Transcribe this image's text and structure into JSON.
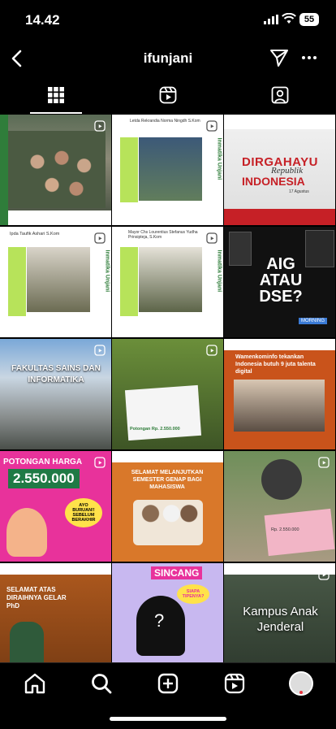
{
  "status": {
    "time": "14.42",
    "battery": "55"
  },
  "header": {
    "username": "ifunjani"
  },
  "tabs": [
    {
      "name": "grid"
    },
    {
      "name": "reels"
    },
    {
      "name": "tagged"
    }
  ],
  "posts": [
    {
      "caption": ""
    },
    {
      "caption": "Letda Rekrandia Norma Ningdh S.Kom",
      "side": "Inmatika Unjani"
    },
    {
      "title1": "DIRGAHAYU",
      "title2": "Republik",
      "title3": "INDONESIA",
      "date": "17 Agustus"
    },
    {
      "caption": "Ipda Taufik Ashari S.Kom",
      "side": "Inmatika Unjani"
    },
    {
      "caption": "Mayor Chs Lourentius Stefanus Yudha Prinsipteja, S.Kom",
      "side": "Inmatika Unjani"
    },
    {
      "text": "AIG ATAU DSE?",
      "tag": "MORNING"
    },
    {
      "text": "FAKULTAS SAINS DAN INFORMATIKA"
    },
    {
      "text": "Potongan Rp. 2.550.000"
    },
    {
      "text": "Wamenkominfo tekankan Indonesia butuh 9 juta talenta digital"
    },
    {
      "text1": "POTONGAN HARGA",
      "amount": "2.550.000",
      "text2": "AYO BURUAN!! SEBELUM BERAKHIR"
    },
    {
      "text": "SELAMAT MELANJUTKAN SEMESTER GENAP BAGI MAHASISWA"
    },
    {
      "text": "Rp. 2.550.000"
    },
    {
      "text": "SELAMAT ATAS DIRAIHNYA GELAR PhD"
    },
    {
      "text": "SINCANG",
      "badge": "SIAPA TIPENYA?"
    },
    {
      "text": "Kampus Anak Jenderal"
    }
  ],
  "colors": {
    "accent_green": "#2f7d3a",
    "lime": "#a8e063",
    "purple": "#6a3dbd",
    "pink": "#e8329b"
  }
}
